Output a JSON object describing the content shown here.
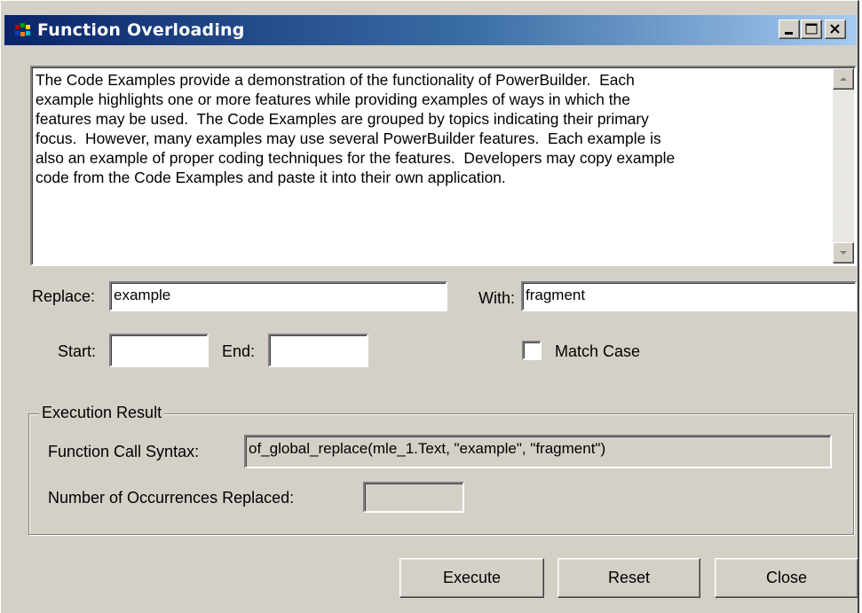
{
  "window": {
    "title": "Function Overloading",
    "controls": {
      "minimize": "minimize-icon",
      "maximize": "maximize-icon",
      "close": "close-icon"
    }
  },
  "description": "The Code Examples provide a demonstration of the functionality of PowerBuilder.  Each\nexample highlights one or more features while providing examples of ways in which the\nfeatures may be used.  The Code Examples are grouped by topics indicating their primary\nfocus.  However, many examples may use several PowerBuilder features.  Each example is\nalso an example of proper coding techniques for the features.  Developers may copy example\ncode from the Code Examples and paste it into their own application.",
  "replace": {
    "label": "Replace:",
    "value": "example"
  },
  "with": {
    "label": "With:",
    "value": "fragment"
  },
  "start": {
    "label": "Start:",
    "value": ""
  },
  "end": {
    "label": "End:",
    "value": ""
  },
  "match_case": {
    "label": "Match Case",
    "checked": false
  },
  "execution_result": {
    "group_label": "Execution Result",
    "syntax_label": "Function Call Syntax:",
    "syntax_value": "of_global_replace(mle_1.Text, \"example\", \"fragment\")",
    "occurrences_label": "Number of Occurrences Replaced:",
    "occurrences_value": ""
  },
  "buttons": {
    "execute": "Execute",
    "reset": "Reset",
    "close": "Close"
  },
  "colors": {
    "titlebar_start": "#0a246a",
    "titlebar_end": "#a6caf0",
    "face": "#d4d0c8"
  }
}
